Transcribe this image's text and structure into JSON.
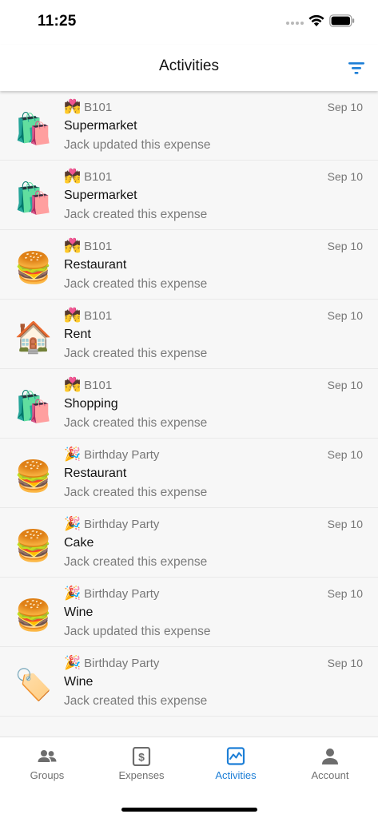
{
  "status_bar": {
    "time": "11:25"
  },
  "header": {
    "title": "Activities"
  },
  "colors": {
    "accent": "#1c7ed6",
    "text_secondary": "#777777",
    "background": "#f7f7f7"
  },
  "activities": [
    {
      "icon": "shopping-bags-icon",
      "emoji": "🛍️",
      "group_icon": "kiss-emoji-icon",
      "group_emoji": "💏",
      "group": "B101",
      "date": "Sep 10",
      "title": "Supermarket",
      "description": "Jack updated this expense"
    },
    {
      "icon": "shopping-bags-icon",
      "emoji": "🛍️",
      "group_icon": "kiss-emoji-icon",
      "group_emoji": "💏",
      "group": "B101",
      "date": "Sep 10",
      "title": "Supermarket",
      "description": "Jack created this expense"
    },
    {
      "icon": "burger-icon",
      "emoji": "🍔",
      "group_icon": "kiss-emoji-icon",
      "group_emoji": "💏",
      "group": "B101",
      "date": "Sep 10",
      "title": "Restaurant",
      "description": "Jack created this expense"
    },
    {
      "icon": "house-icon",
      "emoji": "🏠",
      "group_icon": "kiss-emoji-icon",
      "group_emoji": "💏",
      "group": "B101",
      "date": "Sep 10",
      "title": "Rent",
      "description": "Jack created this expense"
    },
    {
      "icon": "shopping-bags-icon",
      "emoji": "🛍️",
      "group_icon": "kiss-emoji-icon",
      "group_emoji": "💏",
      "group": "B101",
      "date": "Sep 10",
      "title": "Shopping",
      "description": "Jack created this expense"
    },
    {
      "icon": "burger-icon",
      "emoji": "🍔",
      "group_icon": "party-popper-icon",
      "group_emoji": "🎉",
      "group": "Birthday Party",
      "date": "Sep 10",
      "title": "Restaurant",
      "description": "Jack created this expense"
    },
    {
      "icon": "burger-icon",
      "emoji": "🍔",
      "group_icon": "party-popper-icon",
      "group_emoji": "🎉",
      "group": "Birthday Party",
      "date": "Sep 10",
      "title": "Cake",
      "description": "Jack created this expense"
    },
    {
      "icon": "burger-icon",
      "emoji": "🍔",
      "group_icon": "party-popper-icon",
      "group_emoji": "🎉",
      "group": "Birthday Party",
      "date": "Sep 10",
      "title": "Wine",
      "description": "Jack updated this expense"
    },
    {
      "icon": "price-tag-icon",
      "emoji": "🏷️",
      "group_icon": "party-popper-icon",
      "group_emoji": "🎉",
      "group": "Birthday Party",
      "date": "Sep 10",
      "title": "Wine",
      "description": "Jack created this expense"
    }
  ],
  "tabs": [
    {
      "label": "Groups",
      "icon": "groups-icon",
      "active": false
    },
    {
      "label": "Expenses",
      "icon": "dollar-receipt-icon",
      "active": false
    },
    {
      "label": "Activities",
      "icon": "activity-chart-icon",
      "active": true
    },
    {
      "label": "Account",
      "icon": "person-icon",
      "active": false
    }
  ]
}
